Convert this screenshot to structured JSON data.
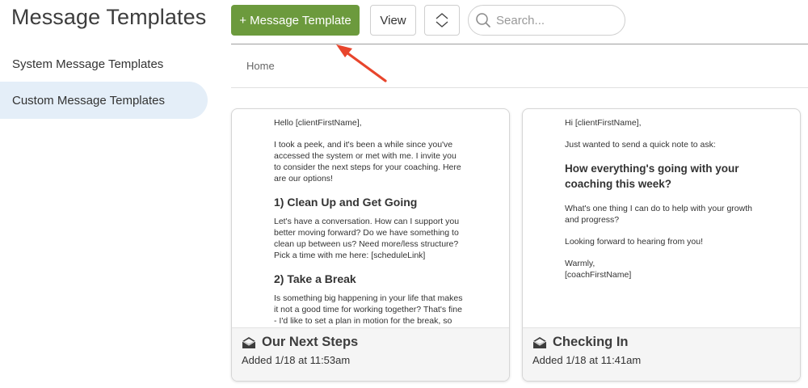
{
  "sidebar": {
    "title": "Message Templates",
    "items": [
      {
        "label": "System Message Templates",
        "active": false
      },
      {
        "label": "Custom Message Templates",
        "active": true
      }
    ]
  },
  "toolbar": {
    "add_label": "+ Message Template",
    "view_label": "View",
    "search_placeholder": "Search...",
    "add_color": "#6c9a3d"
  },
  "breadcrumb": {
    "home": "Home"
  },
  "annotation": {
    "arrow_color": "#e8452c"
  },
  "cards": [
    {
      "title": "Our Next Steps",
      "date": "Added 1/18 at 11:53am",
      "icon": "envelope-open-icon",
      "preview": {
        "greeting": "Hello [clientFirstName],",
        "intro": "I took a peek, and it's been a while since you've accessed the system or met with me. I invite you to consider the next steps for your coaching. Here are our options!",
        "h1": "1) Clean Up and Get Going",
        "p1": "Let's have a conversation. How can I support you better moving forward? Do we have something to clean up between us? Need more/less structure? Pick a time with me here: [scheduleLink]",
        "h2": "2) Take a Break",
        "p2": "Is something big happening in your life that makes it not a good time for working together? That's fine - I'd like to set a plan in motion for the break, so that it's not a slow fade-out but more an orchestrated and"
      }
    },
    {
      "title": "Checking In",
      "date": "Added 1/18 at 11:41am",
      "icon": "envelope-open-icon",
      "preview": {
        "greeting": "Hi [clientFirstName],",
        "intro": "Just wanted to send a quick note to ask:",
        "heading": "How everything's going with your coaching this week?",
        "p1": "What's one thing I can do to help with your growth and progress?",
        "p2": "Looking forward to hearing from you!",
        "signoff": "Warmly,",
        "signature": "[coachFirstName]"
      }
    }
  ]
}
